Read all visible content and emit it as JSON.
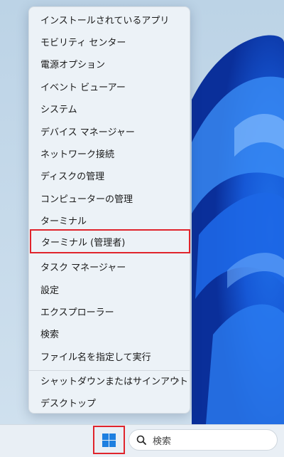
{
  "menu": {
    "items": [
      {
        "label": "インストールされているアプリ"
      },
      {
        "label": "モビリティ センター"
      },
      {
        "label": "電源オプション"
      },
      {
        "label": "イベント ビューアー"
      },
      {
        "label": "システム"
      },
      {
        "label": "デバイス マネージャー"
      },
      {
        "label": "ネットワーク接続"
      },
      {
        "label": "ディスクの管理"
      },
      {
        "label": "コンピューターの管理"
      },
      {
        "label": "ターミナル"
      },
      {
        "label": "ターミナル (管理者)"
      },
      {
        "label": "タスク マネージャー"
      },
      {
        "label": "設定"
      },
      {
        "label": "エクスプローラー"
      },
      {
        "label": "検索"
      },
      {
        "label": "ファイル名を指定して実行"
      },
      {
        "label": "シャットダウンまたはサインアウト"
      },
      {
        "label": "デスクトップ"
      }
    ],
    "highlighted_item": "ターミナル (管理者)",
    "submenu_chevron": "›"
  },
  "taskbar": {
    "start_icon": "windows-logo-icon",
    "search_label": "検索",
    "search_icon": "search-icon"
  },
  "colors": {
    "accent": "#1e7fe0",
    "highlight_border": "#e0242c"
  }
}
